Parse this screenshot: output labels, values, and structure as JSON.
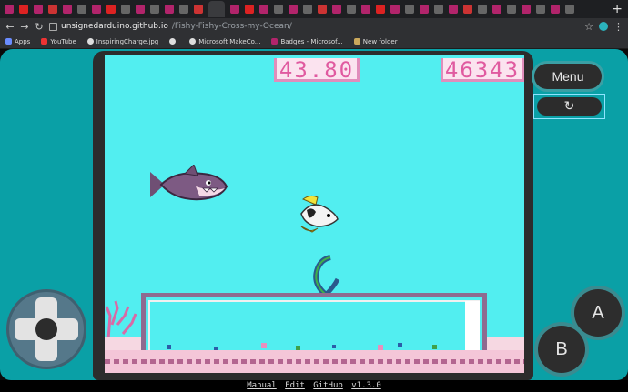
{
  "browser": {
    "url_host": "unsignedarduino.github.io",
    "url_path": "/Fishy-Fishy-Cross-my-Ocean/",
    "bookmarks": [
      "Apps",
      "YouTube",
      "InspiringCharge.jpg",
      "",
      "Microsoft MakeCo...",
      "Badges - Microsof...",
      "New folder"
    ]
  },
  "hud": {
    "timer": "43.80",
    "score": "46343"
  },
  "controls": {
    "menu_label": "Menu",
    "restart_icon": "↻",
    "a_label": "A",
    "b_label": "B",
    "dpad_icon": "dpad-icon"
  },
  "footer": {
    "manual": "Manual",
    "edit": "Edit",
    "github": "GitHub",
    "version": "v1.3.0"
  },
  "colors": {
    "water": "#52eef0",
    "frame_teal": "#0aa0a6",
    "score_text": "#e05aa0",
    "tank_border": "#8e6b90"
  }
}
